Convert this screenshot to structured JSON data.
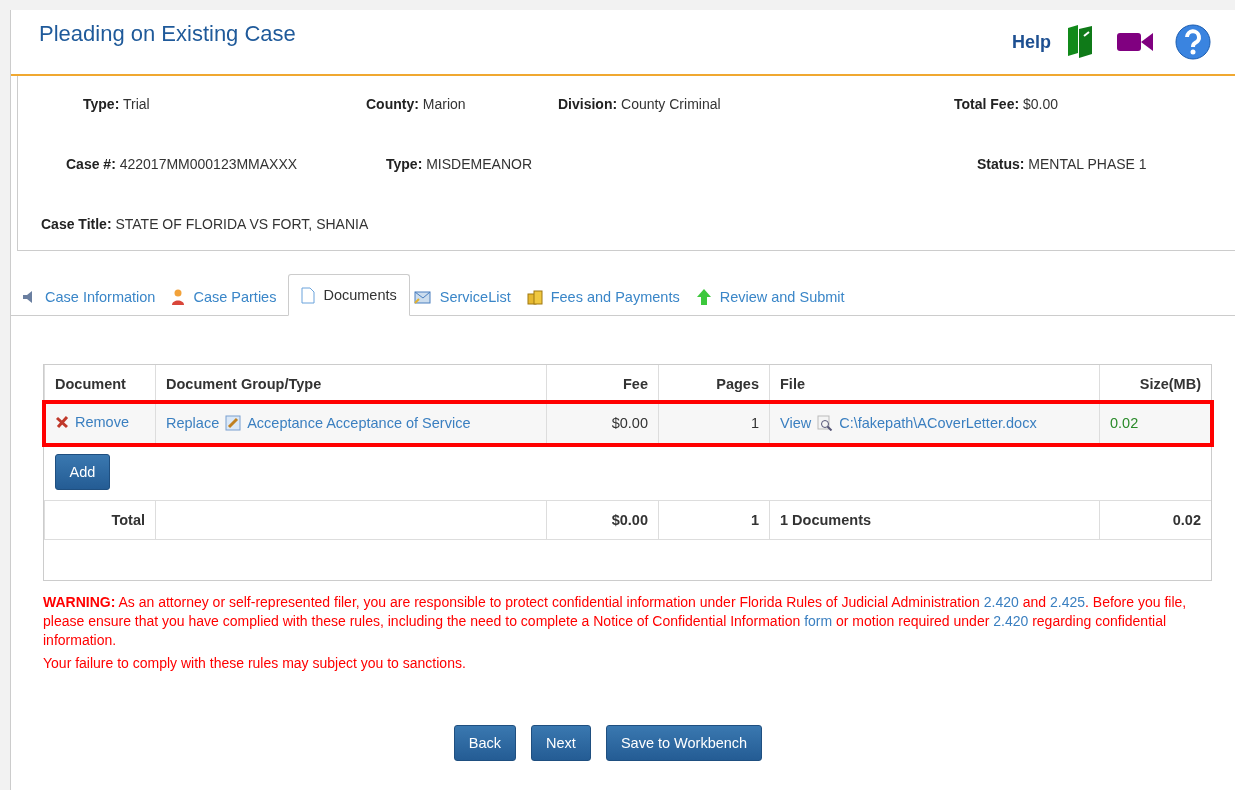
{
  "header": {
    "title": "Pleading on Existing Case",
    "help": "Help"
  },
  "case_info": [
    [
      {
        "label": "Type:",
        "value": "Trial"
      },
      {
        "label": "County:",
        "value": "Marion"
      },
      {
        "label": "Division:",
        "value": "County Criminal"
      },
      {
        "label": "Total Fee:",
        "value": "$0.00"
      }
    ],
    [
      {
        "label": "Case #:",
        "value": "422017MM000123MMAXXX"
      },
      {
        "label": "Type:",
        "value": "MISDEMEANOR"
      },
      {
        "label": "Status:",
        "value": "MENTAL PHASE 1"
      }
    ],
    [
      {
        "label": "Case Title:",
        "value": "STATE OF FLORIDA VS FORT, SHANIA"
      }
    ]
  ],
  "tabs": [
    {
      "label": "Case Information",
      "kind": "info",
      "selected": false
    },
    {
      "label": "Case Parties",
      "kind": "person",
      "selected": false
    },
    {
      "label": "Documents",
      "kind": "page",
      "selected": true
    },
    {
      "label": "ServiceList",
      "kind": "list",
      "selected": false
    },
    {
      "label": "Fees and Payments",
      "kind": "coins",
      "selected": false
    },
    {
      "label": "Review and Submit",
      "kind": "arrow",
      "selected": false
    }
  ],
  "table": {
    "columns": [
      "Document",
      "Document Group/Type",
      "Fee",
      "Pages",
      "File",
      "Size(MB)"
    ],
    "rows": [
      {
        "remove": "Remove",
        "replace": "Replace",
        "type": "Acceptance Acceptance of Service",
        "fee": "$0.00",
        "pages": "1",
        "view": "View",
        "file": "C:\\fakepath\\ACoverLetter.docx",
        "size": "0.02",
        "highlighted": true
      }
    ],
    "add_button": "Add",
    "total": {
      "label": "Total",
      "fee": "$0.00",
      "pages": "1",
      "documents": "1 Documents",
      "size": "0.02"
    }
  },
  "warning": [
    {
      "kind": "text",
      "text": "**WARNING:** As an attorney or self-represented filer, you are responsible to protect confidential information under Florida Rules of Judicial Administration "
    },
    {
      "kind": "link",
      "text": "2.420"
    },
    {
      "kind": "text",
      "text": " and "
    },
    {
      "kind": "link",
      "text": "2.425"
    },
    {
      "kind": "text",
      "text": ". Before you file, please ensure that you have complied with these rules, including the need to complete a Notice of Confidential Information "
    },
    {
      "kind": "link",
      "text": "form"
    },
    {
      "kind": "text",
      "text": " or motion required under "
    },
    {
      "kind": "link",
      "text": "2.420"
    },
    {
      "kind": "text",
      "text": " regarding confidential information."
    }
  ],
  "sanctions": "Your failure to comply with these rules may subject you to sanctions.",
  "buttons": [
    "Back",
    "Next",
    "Save to Workbench"
  ]
}
